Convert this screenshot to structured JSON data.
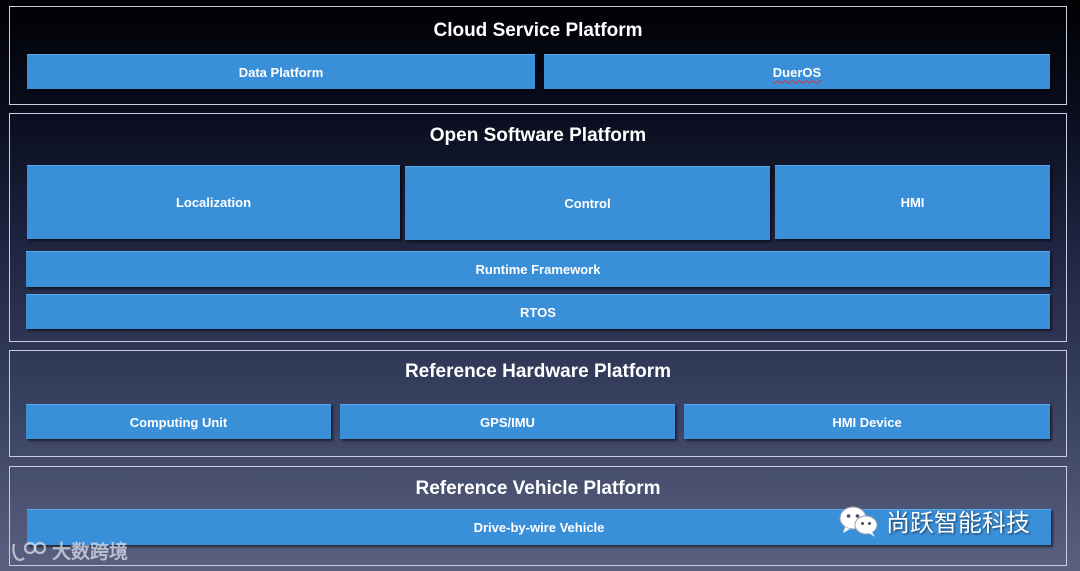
{
  "layers": {
    "cloud": {
      "title": "Cloud Service Platform",
      "items": [
        "Data Platform",
        "DuerOS"
      ]
    },
    "software": {
      "title": "Open Software Platform",
      "items": [
        "Localization",
        "Control",
        "HMI",
        "Runtime Framework",
        "RTOS"
      ]
    },
    "hardware": {
      "title": "Reference Hardware Platform",
      "items": [
        "Computing Unit",
        "GPS/IMU",
        "HMI Device"
      ]
    },
    "vehicle": {
      "title": "Reference Vehicle Platform",
      "items": [
        "Drive-by-wire Vehicle"
      ]
    }
  },
  "watermarks": {
    "right": "尚跃智能科技",
    "left": "大数跨境"
  },
  "colors": {
    "box": "#3a8fd9",
    "border": "#c9cde0",
    "text": "#ffffff"
  },
  "icons": [
    "wechat-icon",
    "logo-icon"
  ]
}
